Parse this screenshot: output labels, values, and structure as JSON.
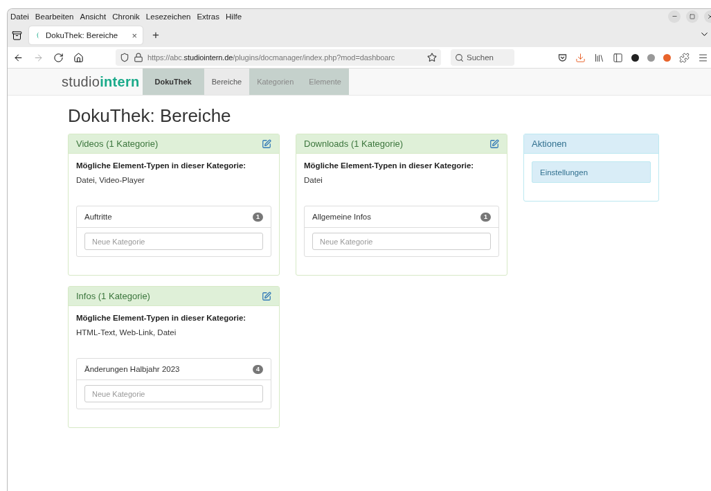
{
  "menu_bar": [
    "Datei",
    "Bearbeiten",
    "Ansicht",
    "Chronik",
    "Lesezeichen",
    "Extras",
    "Hilfe"
  ],
  "tab": {
    "title": "DokuThek: Bereiche",
    "close": "×",
    "new_tab": "+"
  },
  "address_bar": {
    "url_prefix": "https://abc.",
    "url_host": "studiointern.de",
    "url_path": "/plugins/docmanager/index.php?mod=dashboarc"
  },
  "search": {
    "placeholder": "Suchen"
  },
  "site_nav": {
    "logo_a": "studio",
    "logo_b": "intern",
    "items": [
      {
        "label": "DokuThek",
        "kind": "brand",
        "selected": false
      },
      {
        "label": "Bereiche",
        "kind": "link",
        "selected": true
      },
      {
        "label": "Kategorien",
        "kind": "link",
        "selected": false
      },
      {
        "label": "Elemente",
        "kind": "link",
        "selected": false
      }
    ]
  },
  "page_title": "DokuThek: Bereiche",
  "areas": [
    {
      "title": "Videos (1 Kategorie)",
      "types_label": "Mögliche Element-Typen in dieser Kategorie:",
      "types": "Datei, Video-Player",
      "categories": [
        {
          "name": "Auftritte",
          "count": "1"
        }
      ],
      "new_placeholder": "Neue Kategorie"
    },
    {
      "title": "Downloads (1 Kategorie)",
      "types_label": "Mögliche Element-Typen in dieser Kategorie:",
      "types": "Datei",
      "categories": [
        {
          "name": "Allgemeine Infos",
          "count": "1"
        }
      ],
      "new_placeholder": "Neue Kategorie"
    },
    {
      "title": "Infos (1 Kategorie)",
      "types_label": "Mögliche Element-Typen in dieser Kategorie:",
      "types": "HTML-Text, Web-Link, Datei",
      "categories": [
        {
          "name": "Änderungen Halbjahr 2023",
          "count": "4"
        }
      ],
      "new_placeholder": "Neue Kategorie"
    }
  ],
  "actions": {
    "title": "Aktionen",
    "items": [
      "Einstellungen"
    ]
  }
}
